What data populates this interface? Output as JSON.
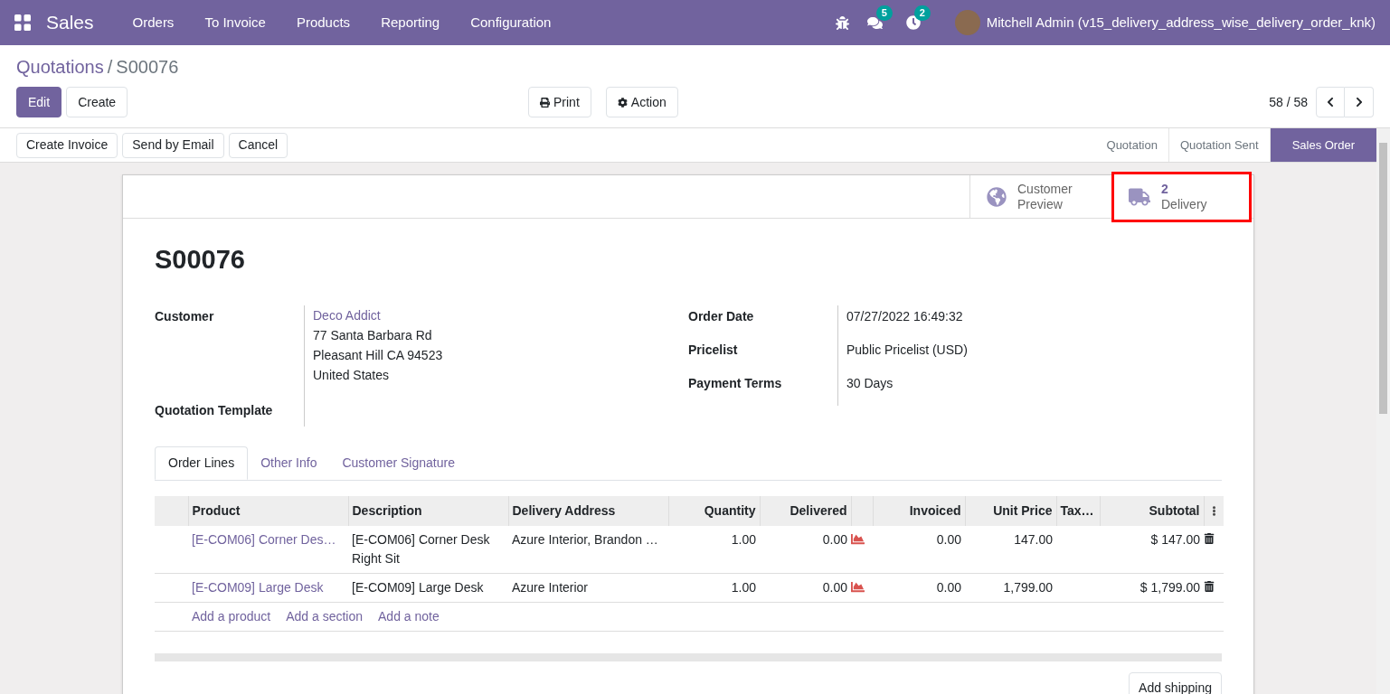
{
  "navbar": {
    "app": "Sales",
    "menu": [
      "Orders",
      "To Invoice",
      "Products",
      "Reporting",
      "Configuration"
    ],
    "messages_badge": "5",
    "activities_badge": "2",
    "user": "Mitchell Admin (v15_delivery_address_wise_delivery_order_knk)"
  },
  "breadcrumb": {
    "parent": "Quotations",
    "separator": "/",
    "current": "S00076"
  },
  "control_buttons": [
    {
      "label": "Edit",
      "kind": "primary"
    },
    {
      "label": "Create",
      "kind": "secondary"
    }
  ],
  "print_button": "Print",
  "action_button": "Action",
  "pager": "58 / 58",
  "header_buttons": [
    "Create Invoice",
    "Send by Email",
    "Cancel"
  ],
  "status_steps": [
    {
      "label": "Quotation",
      "selected": false
    },
    {
      "label": "Quotation Sent",
      "selected": false
    },
    {
      "label": "Sales Order",
      "selected": true
    }
  ],
  "smart_buttons": [
    {
      "kind": "globe",
      "label": "Customer Preview",
      "highlighted": false
    },
    {
      "kind": "truck",
      "value": "2",
      "label": "Delivery",
      "highlighted": true
    }
  ],
  "title": "S00076",
  "left_fields": [
    {
      "label": "Customer",
      "link": "Deco Addict",
      "lines": [
        "77 Santa Barbara Rd",
        "Pleasant Hill CA 94523",
        "United States"
      ]
    },
    {
      "label": "Quotation Template"
    }
  ],
  "right_fields": [
    {
      "label": "Order Date",
      "value": "07/27/2022 16:49:32"
    },
    {
      "label": "Pricelist",
      "value": "Public Pricelist (USD)"
    },
    {
      "label": "Payment Terms",
      "value": "30 Days"
    }
  ],
  "tabs": [
    {
      "label": "Order Lines",
      "selected": true
    },
    {
      "label": "Other Info",
      "selected": false
    },
    {
      "label": "Customer Signature",
      "selected": false
    }
  ],
  "table": {
    "columns": [
      "Product",
      "Description",
      "Delivery Address",
      "Quantity",
      "Delivered",
      "Invoiced",
      "Unit Price",
      "Tax…",
      "Subtotal"
    ],
    "rows": [
      {
        "product": "[E-COM06] Corner Des…",
        "description": "[E-COM06] Corner Desk Right Sit",
        "address": "Azure Interior, Brandon …",
        "quantity": "1.00",
        "delivered": "0.00",
        "invoiced": "0.00",
        "unit_price": "147.00",
        "subtotal": "$ 147.00"
      },
      {
        "product": "[E-COM09] Large Desk",
        "description": "[E-COM09] Large Desk",
        "address": "Azure Interior",
        "quantity": "1.00",
        "delivered": "0.00",
        "invoiced": "0.00",
        "unit_price": "1,799.00",
        "subtotal": "$ 1,799.00"
      }
    ],
    "add_links": [
      "Add a product",
      "Add a section",
      "Add a note"
    ]
  },
  "add_shipping": "Add shipping"
}
